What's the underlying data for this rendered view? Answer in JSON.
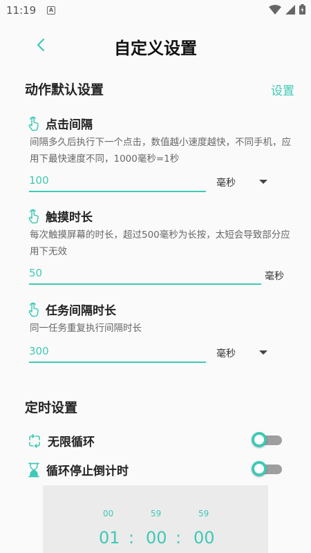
{
  "status_bar": {
    "time": "11:19",
    "notif_letter": "A"
  },
  "header": {
    "title": "自定义设置"
  },
  "default_section": {
    "title": "动作默认设置",
    "action_label": "设置"
  },
  "click_interval": {
    "title": "点击间隔",
    "description": "间隔多久后执行下一个点击，数值越小速度越快，不同手机，应用下最快速度不同，1000毫秒=1秒",
    "value": "100",
    "unit": "毫秒"
  },
  "touch_duration": {
    "title": "触摸时长",
    "description": "每次触摸屏幕的时长，超过500毫秒为长按，太短会导致部分应用下无效",
    "value": "50",
    "unit": "毫秒"
  },
  "task_interval": {
    "title": "任务间隔时长",
    "description": "同一任务重复执行间隔时长",
    "value": "300",
    "unit": "毫秒"
  },
  "timer_section": {
    "title": "定时设置"
  },
  "infinite_loop": {
    "label": "无限循环",
    "enabled": false
  },
  "loop_countdown": {
    "label": "循环停止倒计时",
    "enabled": false
  },
  "time_picker": {
    "hours_next": "00",
    "minutes_next": "59",
    "seconds_next": "59",
    "hours": "01",
    "minutes": "00",
    "seconds": "00",
    "separator": ":"
  },
  "colors": {
    "accent": "#3ec9b5",
    "toggle_track": "#9e9e9e",
    "picker_bg": "#ebebeb"
  },
  "icons": [
    "back-arrow-icon",
    "tap-hand-icon",
    "loop-icon",
    "hourglass-icon",
    "wifi-icon",
    "signal-icon",
    "battery-icon"
  ]
}
